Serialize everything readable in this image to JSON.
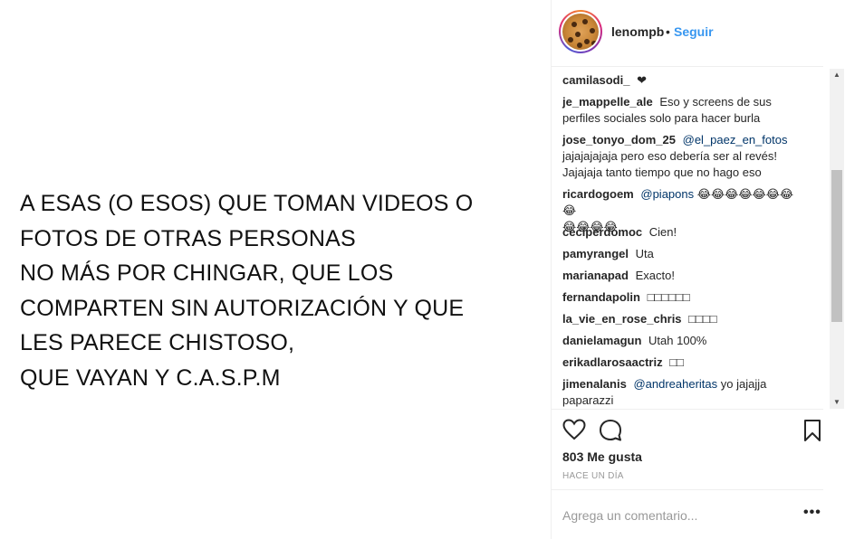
{
  "post": {
    "lines": [
      "A ESAS (O ESOS) QUE TOMAN VIDEOS O",
      "FOTOS DE OTRAS PERSONAS",
      "NO MÁS POR CHINGAR, QUE LOS",
      "COMPARTEN SIN AUTORIZACIÓN Y QUE",
      "LES PARECE CHISTOSO,",
      "QUE VAYAN Y C.A.S.P.M"
    ]
  },
  "header": {
    "username": "lenompb",
    "separator": "•",
    "follow_label": "Seguir"
  },
  "comments": [
    {
      "user": "camilasodi_",
      "text": "❤"
    },
    {
      "user": "je_mappelle_ale",
      "text": "Eso y screens de sus",
      "text2": "perfiles sociales solo para hacer burla"
    },
    {
      "user": "jose_tonyo_dom_25",
      "mention": "@el_paez_en_fotos",
      "text2": "jajajajajaja pero eso debería ser al revés!",
      "text3": "Jajajaja tanto tiempo que no hago eso"
    },
    {
      "user": "ricardogoem",
      "mention": "@piapons",
      "text": "😂😂😂😂😂😂😂😂",
      "text2": "😂😂😂😂"
    },
    {
      "user": "ceciperdomoc",
      "text": "Cien!"
    },
    {
      "user": "pamyrangel",
      "text": "Uta"
    },
    {
      "user": "marianapad",
      "text": "Exacto!"
    },
    {
      "user": "fernandapolin",
      "text": "□□□□□□"
    },
    {
      "user": "la_vie_en_rose_chris",
      "text": "□□□□"
    },
    {
      "user": "danielamagun",
      "text": "Utah 100%"
    },
    {
      "user": "erikadlarosaactriz",
      "text": "□□"
    },
    {
      "user": "jimenalanis",
      "mention": "@andreaheritas",
      "text": "yo jajajja",
      "text2": "paparazzi"
    }
  ],
  "actions": {
    "likes": "803 Me gusta",
    "timestamp": "HACE UN DÍA"
  },
  "add_comment": {
    "placeholder": "Agrega un comentario...",
    "more": "•••"
  },
  "colors": {
    "link": "#3897f0",
    "mention": "#003569",
    "text": "#262626",
    "muted": "#999999"
  }
}
